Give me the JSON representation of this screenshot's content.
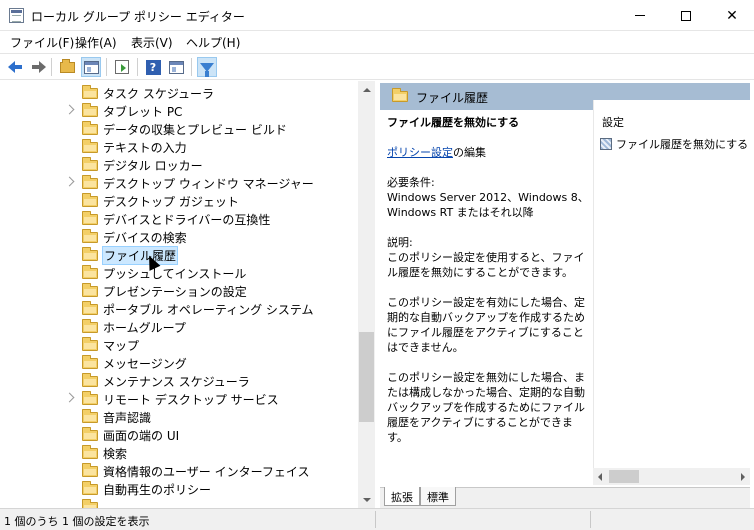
{
  "window": {
    "title": "ローカル グループ ポリシー エディター",
    "minimize": "",
    "maximize": "",
    "close": "✕"
  },
  "menu": [
    "ファイル(F)",
    "操作(A)",
    "表示(V)",
    "ヘルプ(H)"
  ],
  "toolbar": {
    "buttons": [
      "back-icon",
      "forward-icon",
      "up-folder-icon",
      "show-hide-tree-icon",
      "export-list-icon",
      "help-icon",
      "properties-icon",
      "filter-icon"
    ],
    "help_glyph": "?"
  },
  "tree": {
    "items": [
      {
        "label": "タスク スケジューラ",
        "expandable": false
      },
      {
        "label": "タブレット PC",
        "expandable": true
      },
      {
        "label": "データの収集とプレビュー ビルド",
        "expandable": false
      },
      {
        "label": "テキストの入力",
        "expandable": false
      },
      {
        "label": "デジタル ロッカー",
        "expandable": false
      },
      {
        "label": "デスクトップ ウィンドウ マネージャー",
        "expandable": true
      },
      {
        "label": "デスクトップ ガジェット",
        "expandable": false
      },
      {
        "label": "デバイスとドライバーの互換性",
        "expandable": false
      },
      {
        "label": "デバイスの検索",
        "expandable": false
      },
      {
        "label": "ファイル履歴",
        "expandable": false,
        "selected": true
      },
      {
        "label": "プッシュしてインストール",
        "expandable": false
      },
      {
        "label": "プレゼンテーションの設定",
        "expandable": false
      },
      {
        "label": "ポータブル オペレーティング システム",
        "expandable": false
      },
      {
        "label": "ホームグループ",
        "expandable": false
      },
      {
        "label": "マップ",
        "expandable": false
      },
      {
        "label": "メッセージング",
        "expandable": false
      },
      {
        "label": "メンテナンス スケジューラ",
        "expandable": false
      },
      {
        "label": "リモート デスクトップ サービス",
        "expandable": true
      },
      {
        "label": "音声認識",
        "expandable": false
      },
      {
        "label": "画面の端の UI",
        "expandable": false
      },
      {
        "label": "検索",
        "expandable": false
      },
      {
        "label": "資格情報のユーザー インターフェイス",
        "expandable": false
      },
      {
        "label": "自動再生のポリシー",
        "expandable": false
      },
      {
        "label": "...",
        "expandable": false
      }
    ]
  },
  "right_pane": {
    "header_title": "ファイル履歴",
    "policy_title": "ファイル履歴を無効にする",
    "edit_link": "ポリシー設定",
    "edit_suffix": "の編集",
    "requirements_label": "必要条件:",
    "requirements_text": "Windows Server 2012、Windows 8、Windows RT またはそれ以降",
    "description_label": "説明:",
    "description_p1": "このポリシー設定を使用すると、ファイル履歴を無効にすることができます。",
    "description_p2": "このポリシー設定を有効にした場合、定期的な自動バックアップを作成するためにファイル履歴をアクティブにすることはできません。",
    "description_p3": "このポリシー設定を無効にした場合、または構成しなかった場合、定期的な自動バックアップを作成するためにファイル履歴をアクティブにすることができます。",
    "column_header": "設定",
    "settings": [
      "ファイル履歴を無効にする"
    ],
    "tabs": [
      "拡張",
      "標準"
    ]
  },
  "status": {
    "text": "1 個のうち 1 個の設定を表示"
  },
  "colors": {
    "header_bg": "#a6bcd3",
    "selection_bg": "#cce8ff",
    "link": "#0645ad"
  }
}
